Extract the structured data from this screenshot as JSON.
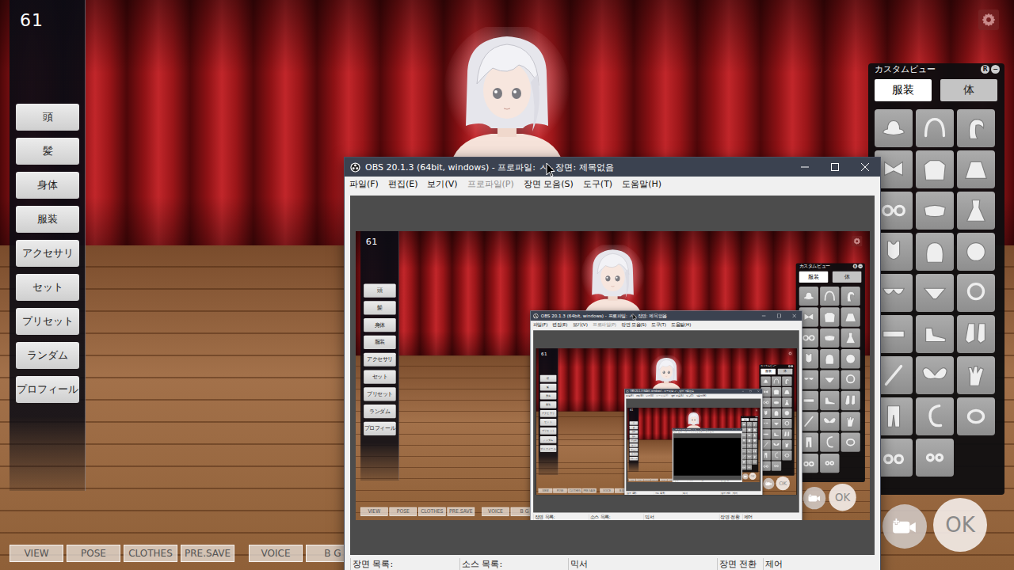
{
  "game": {
    "counter": "61",
    "menu": [
      "頭",
      "髪",
      "身体",
      "服装",
      "アクセサリ",
      "セット",
      "プリセット",
      "ランダム",
      "プロフィール"
    ],
    "bottom_bar": {
      "groups": [
        [
          "VIEW",
          "POSE",
          "CLOTHES",
          "PRE.SAVE"
        ],
        [
          "VOICE",
          "B G"
        ]
      ]
    },
    "custom_view": {
      "title": "カスタムビュー",
      "header_buttons": [
        "R",
        "−"
      ],
      "tabs": [
        {
          "label": "服装",
          "selected": true
        },
        {
          "label": "体",
          "selected": false
        }
      ],
      "items": [
        {
          "kind": "hat"
        },
        {
          "kind": "headband"
        },
        {
          "kind": "hairpiece"
        },
        {
          "kind": "bow"
        },
        {
          "kind": "jacket"
        },
        {
          "kind": "skirt"
        },
        {
          "kind": "glasses"
        },
        {
          "kind": "mask"
        },
        {
          "kind": "dress"
        },
        {
          "kind": "swimsuit"
        },
        {
          "kind": "hood"
        },
        {
          "kind": "face"
        },
        {
          "kind": "bra"
        },
        {
          "kind": "panties"
        },
        {
          "kind": "choker"
        },
        {
          "kind": "belt"
        },
        {
          "kind": "shoe"
        },
        {
          "kind": "socks"
        },
        {
          "kind": "wand"
        },
        {
          "kind": "wings"
        },
        {
          "kind": "gloves"
        },
        {
          "kind": "tights"
        },
        {
          "kind": "tail"
        },
        {
          "kind": "bracelet"
        },
        {
          "kind": "earrings"
        },
        {
          "kind": "piercing"
        }
      ]
    },
    "ok_button": "OK"
  },
  "obs_window": {
    "title": "OBS 20.1.3 (64bit, windows) - 프로파일: ㅅ - 장면: 제목없음",
    "menu": [
      {
        "label": "파일(F)",
        "disabled": false
      },
      {
        "label": "편집(E)",
        "disabled": false
      },
      {
        "label": "보기(V)",
        "disabled": false
      },
      {
        "label": "프로파일(P)",
        "disabled": true
      },
      {
        "label": "장면 모음(S)",
        "disabled": false
      },
      {
        "label": "도구(T)",
        "disabled": false
      },
      {
        "label": "도움말(H)",
        "disabled": false
      }
    ],
    "docks": [
      "장면 목록:",
      "소스 목록:",
      "믹서",
      "장면 전환",
      "제어"
    ]
  }
}
